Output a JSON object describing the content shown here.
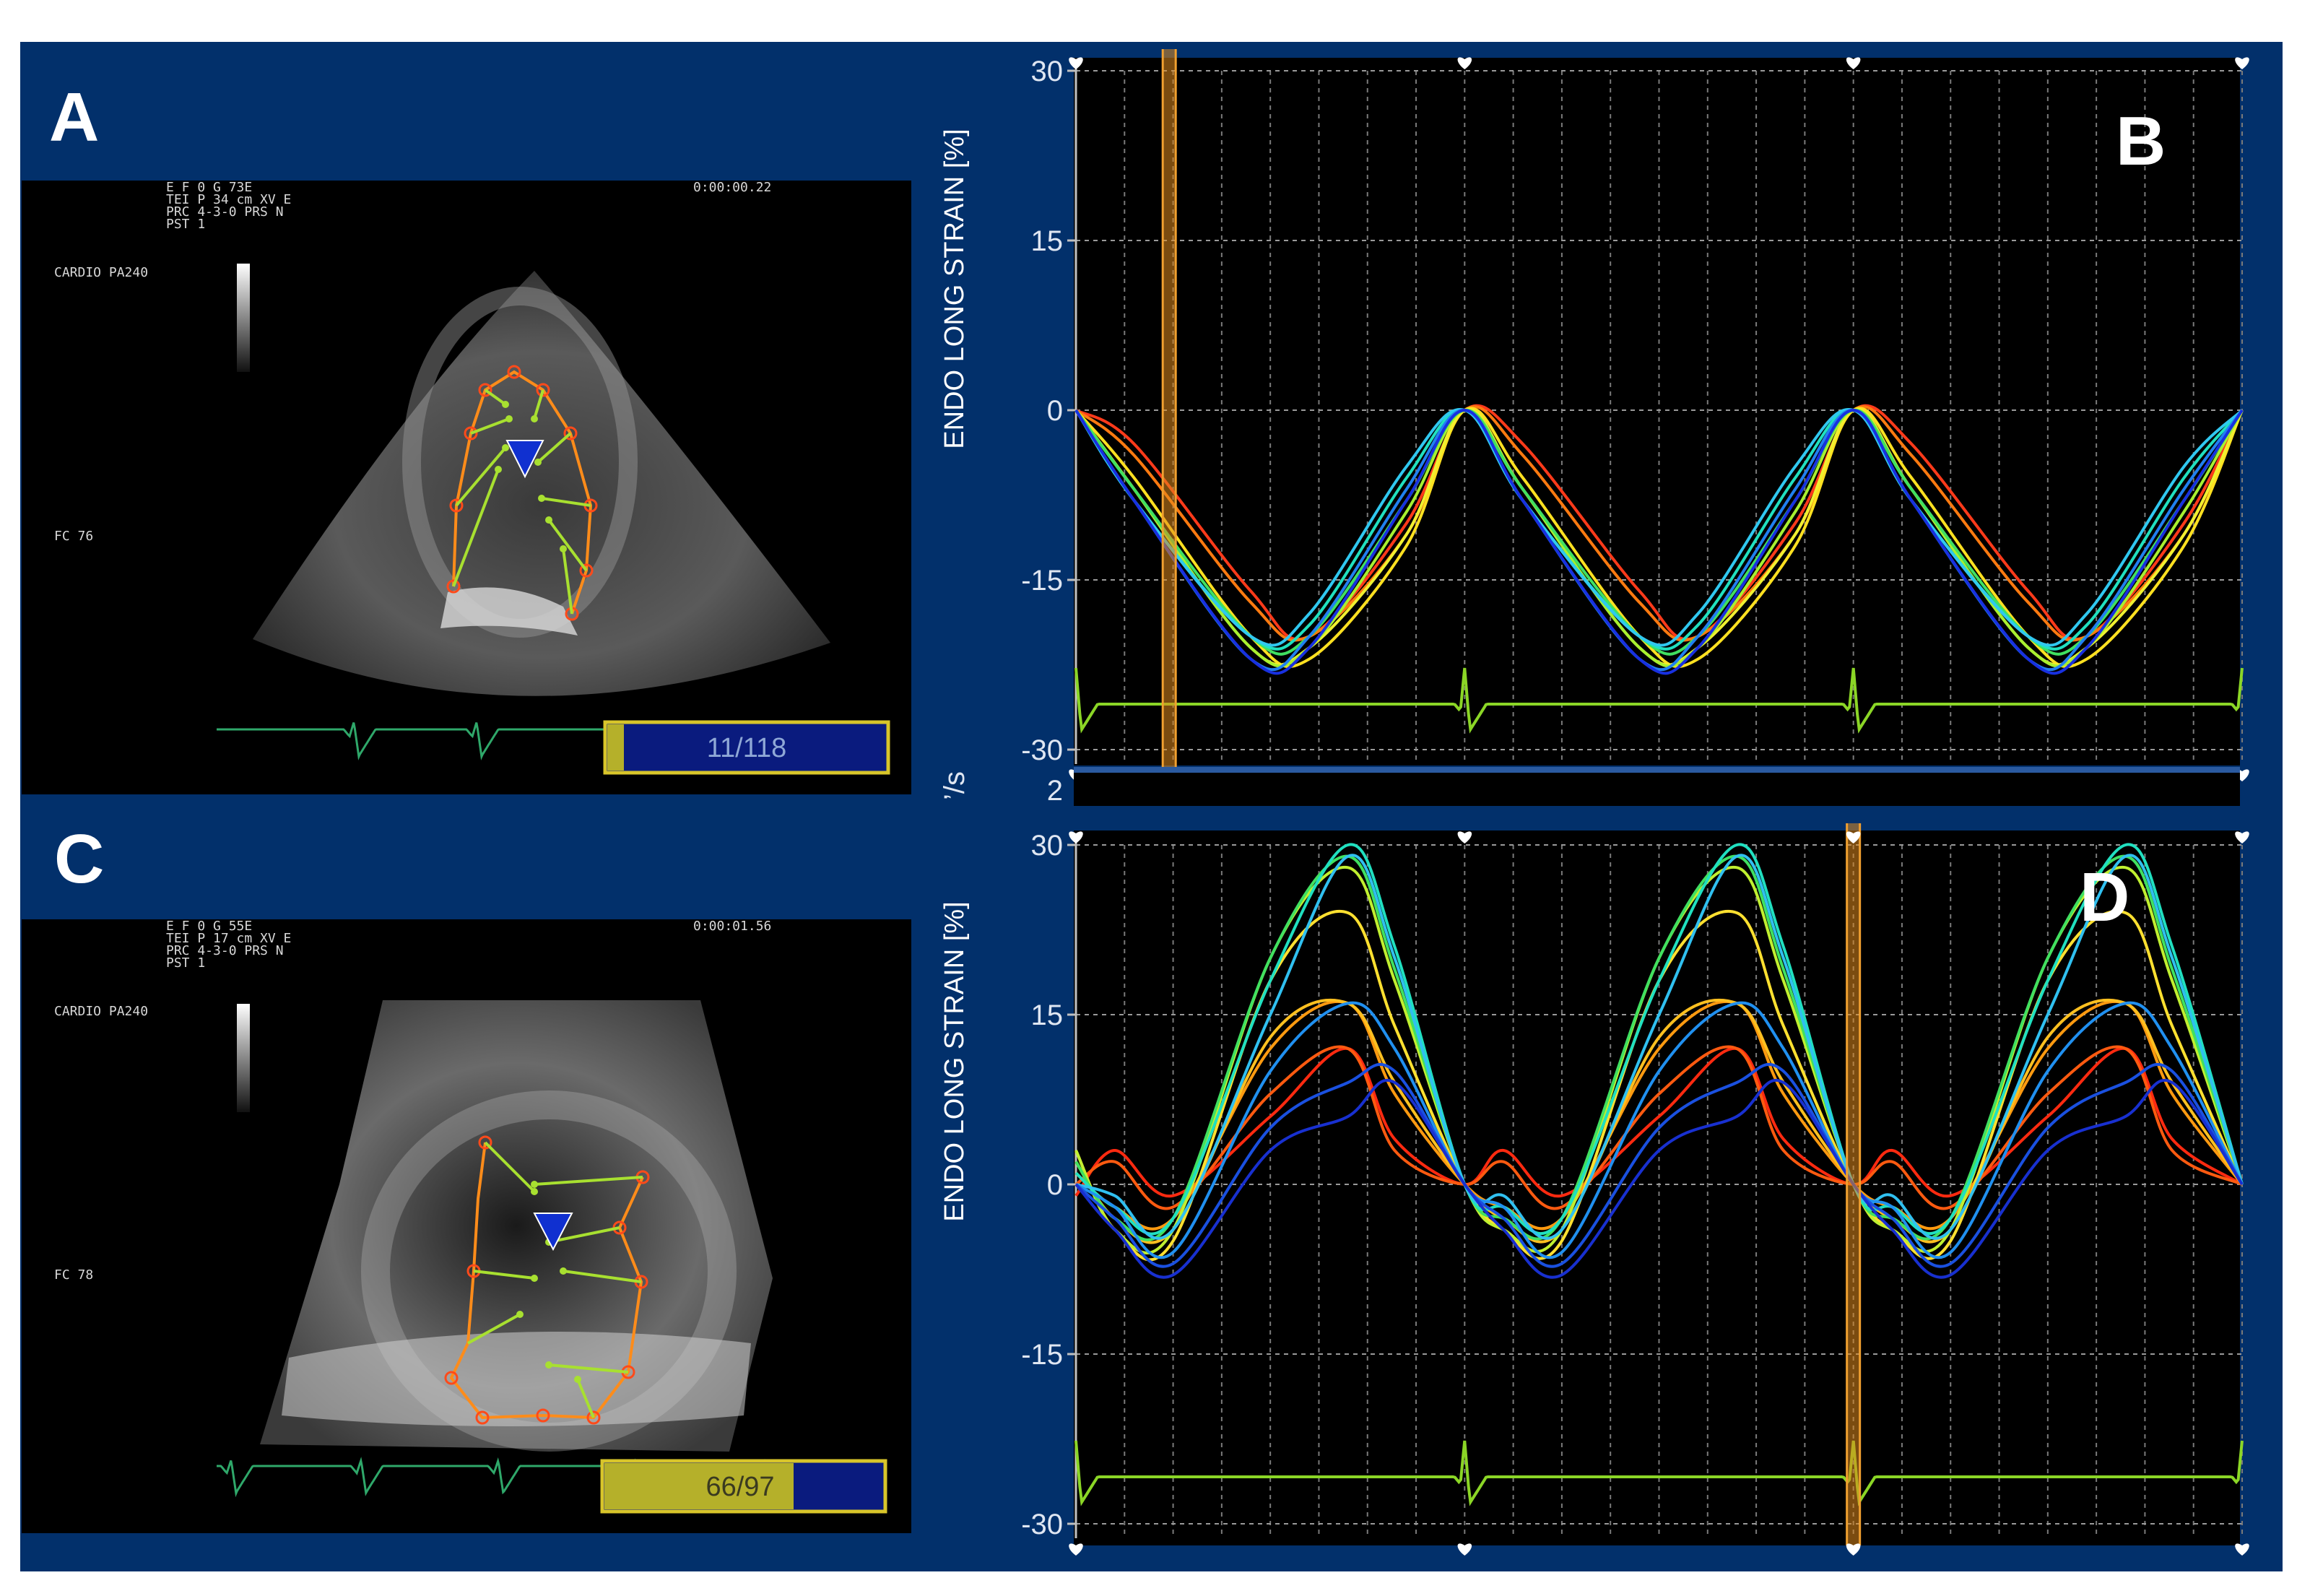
{
  "colors": {
    "navy": "#02306b",
    "plot_bg": "#000000",
    "grid": "#8a8a8a",
    "ecg": "#8bd626",
    "cursor": "#e08a1e",
    "frame_box_fill": "#0a1b7e",
    "frame_box_gold": "#b5b02a",
    "frame_box_border": "#d8c52a"
  },
  "panels": {
    "a": {
      "letter": "A",
      "frame_counter": "11/118",
      "frame_fill_fraction": 0.06
    },
    "b": {
      "letter": "B"
    },
    "c": {
      "letter": "C",
      "frame_counter": "66/97",
      "frame_fill_fraction": 0.68
    },
    "d": {
      "letter": "D"
    }
  },
  "echo_a": {
    "header_lines": [
      "E F   0     G  73E",
      "TEI P  34  cm  XV   E",
      "    PRC  4-3-0  PRS  N",
      "    PST  1"
    ],
    "timestamp": "0:00:00.22",
    "mode": "CARDIO   PA240",
    "hr": "FC  76"
  },
  "echo_c": {
    "header_lines": [
      "E F   0     G  55E",
      "TEI P  17  cm  XV   E",
      "    PRC  4-3-0  PRS  N",
      "    PST  1"
    ],
    "timestamp": "0:00:01.56",
    "mode": "CARDIO   PA240",
    "hr": "FC  78"
  },
  "chart_data": [
    {
      "type": "line",
      "panel": "B",
      "ylabel": "ENDO LONG STRAIN [%]",
      "ylim": [
        -30,
        30
      ],
      "yticks": [
        30,
        15,
        0,
        -15,
        -30
      ],
      "grid": true,
      "xlim": [
        0,
        3
      ],
      "cursor_x": 0.24,
      "beat_markers_x": [
        0,
        1,
        2,
        3
      ],
      "series": [
        {
          "color": "#ff3a1a",
          "x": [
            0,
            0.15,
            0.45,
            0.6,
            0.85,
            1
          ],
          "y": [
            0,
            -3,
            -16,
            -20,
            -10,
            0
          ]
        },
        {
          "color": "#ff7a10",
          "x": [
            0,
            0.15,
            0.45,
            0.6,
            0.85,
            1
          ],
          "y": [
            0,
            -4,
            -17,
            -20,
            -11,
            0
          ]
        },
        {
          "color": "#ffe020",
          "x": [
            0,
            0.15,
            0.45,
            0.6,
            0.85,
            1
          ],
          "y": [
            0,
            -6,
            -20,
            -22,
            -12,
            0
          ]
        },
        {
          "color": "#f0f030",
          "x": [
            0,
            0.15,
            0.45,
            0.6,
            0.85,
            1
          ],
          "y": [
            0,
            -7,
            -21,
            -21,
            -11,
            0
          ]
        },
        {
          "color": "#a8f030",
          "x": [
            0,
            0.15,
            0.45,
            0.6,
            0.85,
            1
          ],
          "y": [
            0,
            -7,
            -21,
            -21,
            -9,
            0
          ]
        },
        {
          "color": "#40e060",
          "x": [
            0,
            0.15,
            0.45,
            0.6,
            0.85,
            1
          ],
          "y": [
            0,
            -7,
            -20,
            -20,
            -8,
            0
          ]
        },
        {
          "color": "#20e0c0",
          "x": [
            0,
            0.15,
            0.45,
            0.6,
            0.85,
            1
          ],
          "y": [
            0,
            -8,
            -20,
            -19,
            -6,
            0
          ]
        },
        {
          "color": "#30c8f0",
          "x": [
            0,
            0.15,
            0.45,
            0.6,
            0.85,
            1
          ],
          "y": [
            0,
            -8,
            -20,
            -18,
            -5,
            0
          ]
        },
        {
          "color": "#2080f0",
          "x": [
            0,
            0.15,
            0.45,
            0.6,
            0.85,
            1
          ],
          "y": [
            0,
            -8,
            -22,
            -20,
            -7,
            0
          ]
        },
        {
          "color": "#1830e0",
          "x": [
            0,
            0.15,
            0.45,
            0.6,
            0.85,
            1
          ],
          "y": [
            0,
            -8,
            -22,
            -21,
            -8,
            0
          ]
        }
      ]
    },
    {
      "type": "line",
      "panel": "D",
      "ylabel": "ENDO LONG STRAIN [%]",
      "ylim": [
        -30,
        30
      ],
      "yticks": [
        30,
        15,
        0,
        -15,
        -30
      ],
      "extra_tick": "2",
      "extra_tick_unit": "’/s",
      "grid": true,
      "xlim": [
        0,
        3
      ],
      "cursor_x": 2.0,
      "beat_markers_x": [
        0,
        1,
        2,
        3
      ],
      "series": [
        {
          "color": "#ff2a10",
          "x": [
            0,
            0.1,
            0.25,
            0.5,
            0.7,
            0.82,
            1
          ],
          "y": [
            -1,
            3,
            -1,
            6,
            12,
            4,
            0
          ]
        },
        {
          "color": "#ff5a10",
          "x": [
            0,
            0.1,
            0.25,
            0.5,
            0.7,
            0.82,
            1
          ],
          "y": [
            0,
            2,
            -2,
            8,
            12,
            3,
            0
          ]
        },
        {
          "color": "#ff9a10",
          "x": [
            0,
            0.1,
            0.25,
            0.5,
            0.7,
            0.82,
            1
          ],
          "y": [
            1,
            -2,
            -3,
            12,
            16,
            8,
            0
          ]
        },
        {
          "color": "#ffc020",
          "x": [
            0,
            0.1,
            0.25,
            0.5,
            0.7,
            0.82,
            1
          ],
          "y": [
            2,
            -3,
            -4,
            13,
            16,
            9,
            0
          ]
        },
        {
          "color": "#ffe030",
          "x": [
            0,
            0.1,
            0.25,
            0.5,
            0.7,
            0.82,
            1
          ],
          "y": [
            3,
            -4,
            -5,
            18,
            24,
            14,
            0
          ]
        },
        {
          "color": "#c0f030",
          "x": [
            0,
            0.1,
            0.25,
            0.5,
            0.7,
            0.82,
            1
          ],
          "y": [
            3,
            -4,
            -4,
            20,
            28,
            18,
            0
          ]
        },
        {
          "color": "#40e060",
          "x": [
            0,
            0.1,
            0.25,
            0.5,
            0.7,
            0.82,
            1
          ],
          "y": [
            2,
            -3,
            -3,
            20,
            29,
            19,
            0
          ]
        },
        {
          "color": "#20e0c0",
          "x": [
            0,
            0.1,
            0.25,
            0.5,
            0.7,
            0.82,
            1
          ],
          "y": [
            1,
            -2,
            -3,
            18,
            30,
            21,
            0
          ]
        },
        {
          "color": "#30c0f0",
          "x": [
            0,
            0.1,
            0.25,
            0.5,
            0.7,
            0.82,
            1
          ],
          "y": [
            0,
            -1,
            -4,
            15,
            29,
            20,
            0
          ]
        },
        {
          "color": "#2090f0",
          "x": [
            0,
            0.1,
            0.25,
            0.5,
            0.7,
            0.82,
            1
          ],
          "y": [
            0,
            -2,
            -6,
            10,
            16,
            12,
            0
          ]
        },
        {
          "color": "#1a50e0",
          "x": [
            0,
            0.1,
            0.25,
            0.5,
            0.7,
            0.82,
            1
          ],
          "y": [
            0,
            -3,
            -7,
            5,
            9,
            10,
            0
          ]
        },
        {
          "color": "#1830d0",
          "x": [
            0,
            0.1,
            0.25,
            0.5,
            0.7,
            0.82,
            1
          ],
          "y": [
            0,
            -4,
            -8,
            3,
            6,
            9,
            0
          ]
        }
      ]
    }
  ]
}
